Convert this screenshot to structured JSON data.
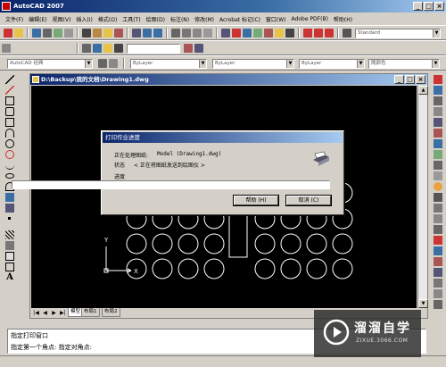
{
  "app": {
    "title": "AutoCAD 2007"
  },
  "menu": [
    "文件(F)",
    "编辑(E)",
    "视图(V)",
    "插入(I)",
    "格式(O)",
    "工具(T)",
    "绘图(D)",
    "标注(N)",
    "修改(M)",
    "Acrobat 标记(C)",
    "窗口(W)",
    "Adobe PDF(B)",
    "帮助(H)"
  ],
  "toolbar": {
    "text_style": "Standard",
    "workspace": "AutoCAD 经典",
    "layer": "ByLayer",
    "linetype": "ByLayer",
    "lineweight": "ByLayer",
    "plot_style": "随颜色"
  },
  "drawing": {
    "title": "D:\\Backup\\我的文档\\Drawing1.dwg",
    "ucs_x": "X",
    "ucs_y": "Y",
    "tabs": [
      "模型",
      "布局1",
      "布局2"
    ]
  },
  "dialog": {
    "title": "打印作业进度",
    "processing_label": "正在处理图纸:",
    "processing_value": "Model (Drawing1.dwg)",
    "status_label": "状态",
    "status_value": "< 正在将图纸发送到绘图仪 >",
    "progress_label": "进度",
    "progress": 0,
    "help_button": "帮助 (H)",
    "cancel_button": "取消 (C)"
  },
  "command": {
    "line1": "指定打印窗口",
    "line2": "指定第一个角点: 指定对角点:"
  },
  "watermark": {
    "name": "溜溜自学",
    "url": "ZIXUE.3066.COM"
  },
  "colors": {
    "canvas": "#000000",
    "titlebar": "#0a246a",
    "chrome": "#d4d0c8"
  }
}
